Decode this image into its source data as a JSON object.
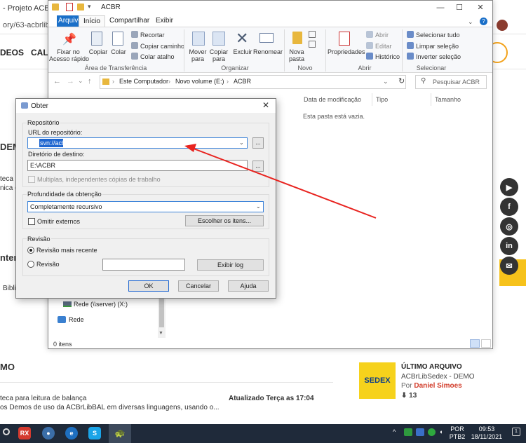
{
  "browser": {
    "tab_title": "- Projeto ACBr",
    "url": "ory/63-acbrlib-",
    "nav1": "DEOS",
    "nav2": "CAL",
    "left_frag_1": "DEM",
    "left_frag_2": "teca p",
    "left_frag_3": "nica (t",
    "left_frag_4": "nter",
    "left_frag_5": "Bibli",
    "section_title": "MO",
    "desc_1": "teca para leitura de balança",
    "desc_2": "os Demos de uso da ACBrLibBAL em diversas linguagens, usando o...",
    "updated": "Atualizado Terça as 17:04",
    "social": [
      "▶",
      "f",
      "◎",
      "in",
      "✉"
    ],
    "card": {
      "logo_text": "SEDEX",
      "title": "ÚLTIMO ARQUIVO",
      "subtitle": "ACBrLibSedex - DEMO",
      "by_prefix": "Por",
      "author": "Daniel Simoes",
      "count": "13"
    }
  },
  "explorer": {
    "title": "ACBR",
    "tabs": [
      "Arquivo",
      "Início",
      "Compartilhar",
      "Exibir"
    ],
    "ribbon": {
      "pin_label": "Fixar no\nAcesso rápido",
      "copy": "Copiar",
      "paste": "Colar",
      "cut": "Recortar",
      "copy_path": "Copiar caminho",
      "paste_shortcut": "Colar atalho",
      "group_clipboard": "Área de Transferência",
      "move_to": "Mover\npara",
      "copy_to": "Copiar\npara",
      "delete": "Excluir",
      "rename": "Renomear",
      "group_organize": "Organizar",
      "new_folder": "Nova\npasta",
      "group_new": "Novo",
      "properties": "Propriedades",
      "open": "Abrir",
      "edit": "Editar",
      "history": "Histórico",
      "group_open": "Abrir",
      "select_all": "Selecionar tudo",
      "clear_selection": "Limpar seleção",
      "invert_selection": "Inverter seleção",
      "group_select": "Selecionar"
    },
    "breadcrumb": [
      "Este Computador",
      "Novo volume (E:)",
      "ACBR"
    ],
    "search_placeholder": "Pesquisar ACBR",
    "columns": [
      "Data de modificação",
      "Tipo",
      "Tamanho"
    ],
    "empty_message": "Esta pasta está vazia.",
    "nav_items": [
      "Rede (\\\\server) (X:)",
      "Rede"
    ],
    "status": "0 itens"
  },
  "dialog": {
    "title": "Obter",
    "repository_group": "Repositório",
    "url_label": "URL do repositório:",
    "url_value": "svn://acbr",
    "dest_label": "Diretório de destino:",
    "dest_value": "E:\\ACBR",
    "multiple_label": "Multiplas, independentes cópias de trabalho",
    "depth_group": "Profundidade da obtenção",
    "depth_value": "Completamente recursivo",
    "omit_externals": "Omitir externos",
    "choose_items": "Escolher os itens...",
    "revision_group": "Revisão",
    "latest_revision": "Revisão mais recente",
    "revision": "Revisão",
    "revision_value": "",
    "show_log": "Exibir log",
    "ok": "OK",
    "cancel": "Cancelar",
    "help": "Ajuda",
    "ellipsis": "..."
  },
  "taskbar": {
    "lang1": "POR",
    "lang2": "PTB2",
    "time": "09:53",
    "date": "18/11/2021"
  },
  "colors": {
    "annotation_arrow": "#e8231f",
    "accent": "#1a6fc8",
    "taskbar": "#1f2a3a"
  }
}
